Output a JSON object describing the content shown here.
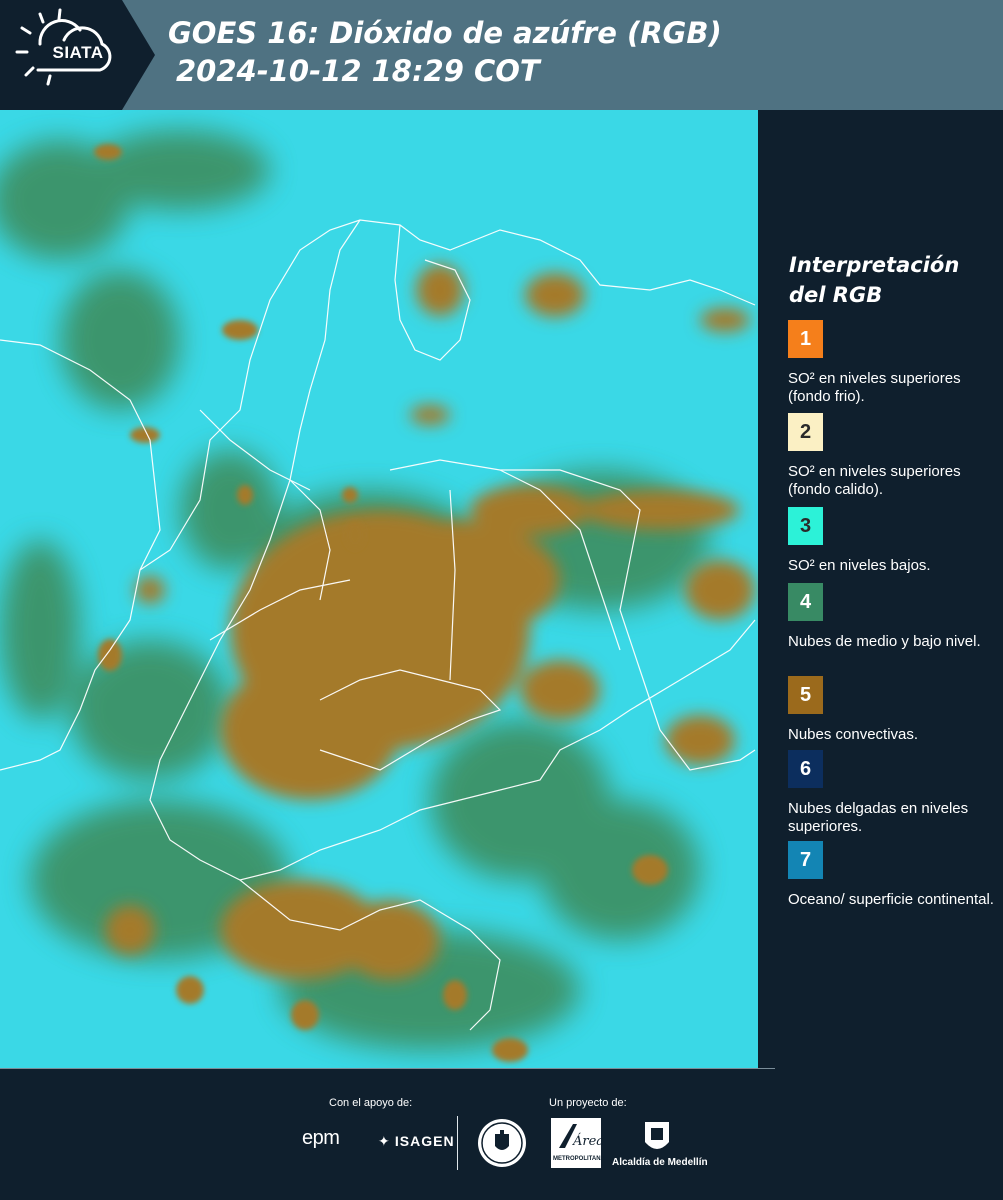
{
  "header": {
    "logo_text": "SIATA",
    "title_line1": "GOES 16: Dióxido de azúfre (RGB)",
    "title_line2": "2024-10-12 18:29 COT"
  },
  "map": {
    "icon": "satellite-rgb-map",
    "colors": {
      "ocean_surface": "#3ad8e6",
      "low_mid_cloud": "#3d8a58",
      "convective": "#a47a2a"
    }
  },
  "legend": {
    "title": "Interpretación del RGB",
    "items": [
      {
        "number": "1",
        "color": "#f57f1b",
        "text_color": "#ffffff",
        "label": "SO² en niveles superiores (fondo frio)."
      },
      {
        "number": "2",
        "color": "#fbf0c4",
        "text_color": "#2a2a2a",
        "label": "SO² en niveles superiores (fondo calido)."
      },
      {
        "number": "3",
        "color": "#2cf2d8",
        "text_color": "#2a2a2a",
        "label": "SO² en niveles bajos."
      },
      {
        "number": "4",
        "color": "#388a64",
        "text_color": "#ffffff",
        "label": "Nubes de medio y bajo nivel."
      },
      {
        "number": "5",
        "color": "#9b6a1c",
        "text_color": "#ffffff",
        "label": "Nubes convectivas."
      },
      {
        "number": "6",
        "color": "#0c2e5e",
        "text_color": "#ffffff",
        "label": "Nubes delgadas en niveles superiores."
      },
      {
        "number": "7",
        "color": "#1385b4",
        "text_color": "#ffffff",
        "label": "Oceano/ superficie continental."
      }
    ]
  },
  "footer": {
    "support_label": "Con el apoyo de:",
    "project_label": "Un proyecto de:",
    "epm_text": "epm",
    "isagen_text": "ISAGEN",
    "area_text": "Área",
    "area_sub": "METROPOLITANA",
    "alcaldia_text": "Alcaldía de Medellín"
  }
}
